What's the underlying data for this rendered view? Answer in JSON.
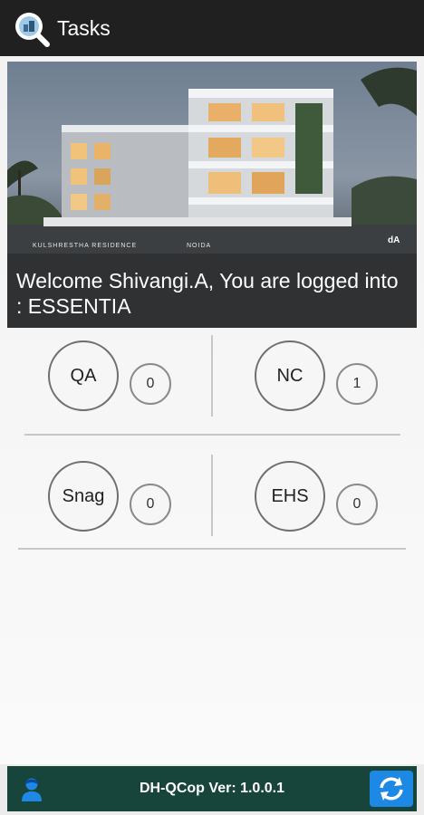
{
  "appbar": {
    "title": "Tasks",
    "logo_icon": "magnifier-logo-icon"
  },
  "banner": {
    "image_caption_left": "KULSHRESTHA RESIDENCE",
    "image_caption_right": "NOIDA",
    "image_logo": "dA",
    "welcome": "Welcome Shivangi.A, You are logged into : ESSENTIA"
  },
  "tiles": [
    {
      "label": "QA",
      "count": "0"
    },
    {
      "label": "NC",
      "count": "1"
    },
    {
      "label": "Snag",
      "count": "0"
    },
    {
      "label": "EHS",
      "count": "0"
    }
  ],
  "footer": {
    "version": "DH-QCop Ver: 1.0.0.1",
    "user_icon": "user-icon",
    "refresh_icon": "refresh-icon"
  },
  "colors": {
    "appbar": "#202020",
    "footer": "#17453c",
    "refresh_button": "#1e88e5"
  }
}
